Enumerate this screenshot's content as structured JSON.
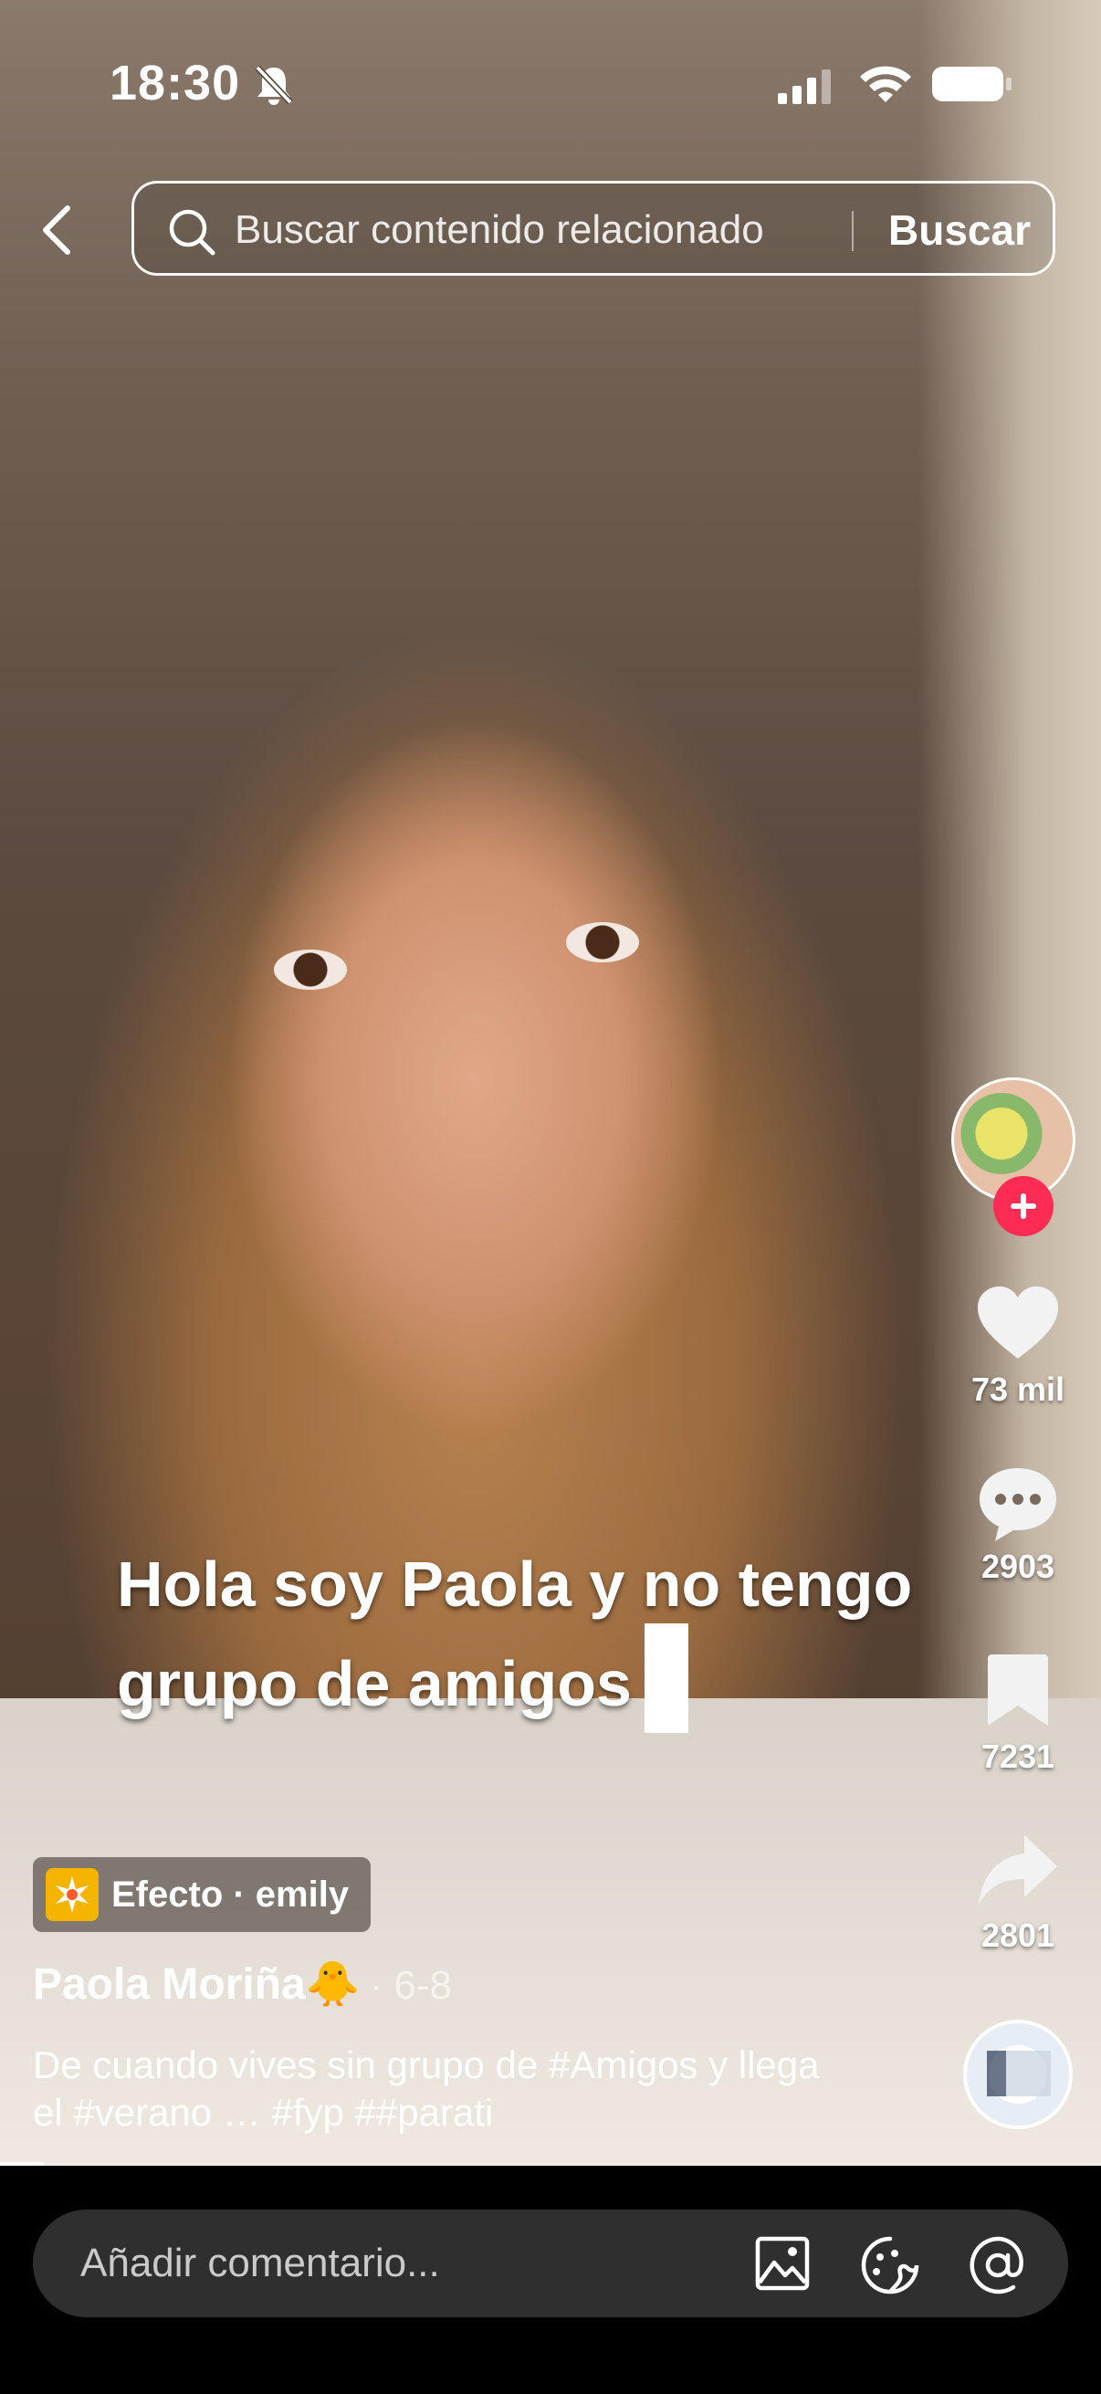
{
  "status_bar": {
    "time": "18:30"
  },
  "search": {
    "placeholder": "Buscar contenido relacionado",
    "button_label": "Buscar"
  },
  "video": {
    "caption_overlay": "Hola soy Paola y no tengo grupo de amigos",
    "progress": 0.04
  },
  "actions": {
    "likes": "73 mil",
    "comments": "2903",
    "saves": "7231",
    "shares": "2801"
  },
  "effect": {
    "label": "Efecto · emily"
  },
  "author": {
    "name": "Paola Moriña🐥",
    "date": "· 6-8"
  },
  "description": {
    "text": "De cuando vives sin grupo de ",
    "tag1": "#Amigos",
    "mid": " y llega el ",
    "tag2": "#verano",
    "mid2": " … ",
    "tag3": "#fyp",
    "space": " ",
    "tag4": "##parati"
  },
  "comment_bar": {
    "placeholder": "Añadir comentario..."
  },
  "colors": {
    "follow_accent": "#fe2c55",
    "effect_icon": "#f5b400"
  }
}
